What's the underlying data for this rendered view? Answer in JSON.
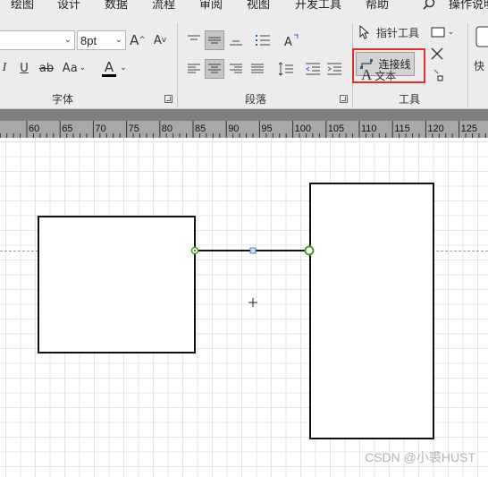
{
  "menu": {
    "tabs": [
      "绘图",
      "设计",
      "数据",
      "流程",
      "审阅",
      "视图",
      "开发工具",
      "帮助"
    ],
    "search_label": "操作说明"
  },
  "ribbon": {
    "font": {
      "size": "8pt",
      "group_label": "字体",
      "bold": "I",
      "underline": "U",
      "strike": "ab",
      "case": "Aa",
      "grow": "A",
      "shrink": "A",
      "color": "A"
    },
    "paragraph": {
      "group_label": "段落"
    },
    "tools": {
      "pointer": "指针工具",
      "connector": "连接线",
      "text": "文本",
      "group_label": "工具"
    },
    "quick": "快"
  },
  "ruler": {
    "labels": [
      "60",
      "65",
      "70",
      "75",
      "80",
      "85",
      "90",
      "95",
      "100",
      "105",
      "110",
      "115",
      "120",
      "125"
    ]
  },
  "icons": [
    "search-icon",
    "pointer-icon",
    "connector-icon",
    "text-icon",
    "close-x-icon",
    "rectangle-icon"
  ],
  "colors": {
    "highlight_box": "#e0302c",
    "connection_point": "#4f9a28",
    "font_color_bar": "#000000"
  },
  "watermark": "CSDN @小裘HUST"
}
